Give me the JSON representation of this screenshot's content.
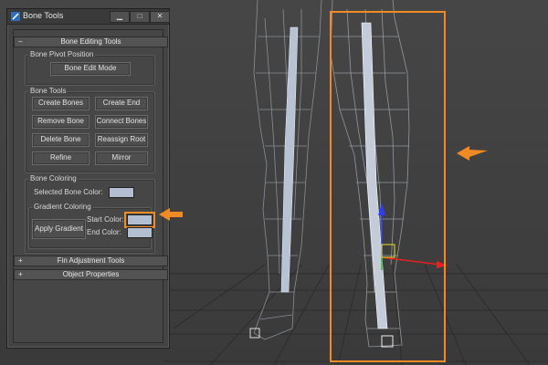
{
  "dialog": {
    "title": "Bone Tools",
    "window_controls": {
      "minimize": "▁",
      "maximize": "□",
      "close": "✕"
    }
  },
  "rollouts": {
    "bone_editing": {
      "sign": "−",
      "label": "Bone Editing Tools"
    },
    "fin_adjustment": {
      "sign": "+",
      "label": "Fin Adjustment Tools"
    },
    "object_properties": {
      "sign": "+",
      "label": "Object Properties"
    }
  },
  "bone_pivot": {
    "group_label": "Bone Pivot Position",
    "edit_mode_button": "Bone Edit Mode"
  },
  "bone_tools": {
    "group_label": "Bone Tools",
    "create_bones": "Create Bones",
    "create_end": "Create End",
    "remove_bone": "Remove Bone",
    "connect_bones": "Connect Bones",
    "delete_bone": "Delete Bone",
    "reassign_root": "Reassign Root",
    "refine": "Refine",
    "mirror": "Mirror"
  },
  "bone_coloring": {
    "group_label": "Bone Coloring",
    "selected_color_label": "Selected Bone Color:",
    "gradient_group_label": "Gradient Coloring",
    "apply_gradient": "Apply Gradient",
    "start_color_label": "Start Color:",
    "end_color_label": "End Color:"
  },
  "colors": {
    "accent_highlight": "#f08a24",
    "swatch_color": "#b3bfd0"
  }
}
